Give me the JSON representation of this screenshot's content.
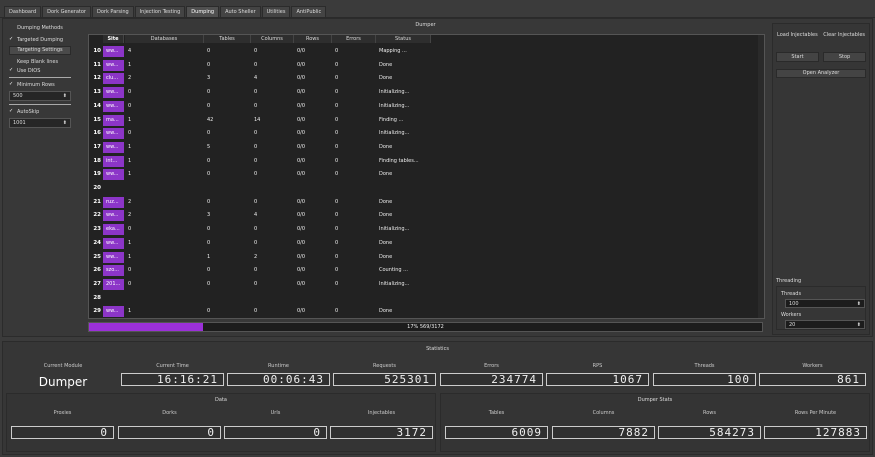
{
  "tabs": [
    "Dashboard",
    "Dork Generator",
    "Dork Parsing",
    "Injection Testing",
    "Dumping",
    "Auto Sheller",
    "Utilities",
    "AntiPublic"
  ],
  "active_tab": "Dumping",
  "left": {
    "header": "Dumping Methods",
    "targeted_dumping": "Targeted Dumping",
    "targeting_settings": "Targeting Settings",
    "keep_blank_lines": "Keep Blank lines",
    "use_dios": "Use DIOS",
    "minimum_rows": "Minimum Rows",
    "minimum_rows_value": "500",
    "autoskip": "AutoSkip",
    "autoskip_value": "1001"
  },
  "dumper": {
    "title": "Dumper",
    "columns": [
      "Site",
      "Databases",
      "Tables",
      "Columns",
      "Rows",
      "Errors",
      "Status"
    ],
    "rows": [
      {
        "n": "10",
        "site": "ww...",
        "db": "4",
        "tables": "0",
        "columns": "0",
        "rows": "0/0",
        "errors": "0",
        "status": "Mapping ..."
      },
      {
        "n": "11",
        "site": "ww...",
        "db": "1",
        "tables": "0",
        "columns": "0",
        "rows": "0/0",
        "errors": "0",
        "status": "Done"
      },
      {
        "n": "12",
        "site": "clu...",
        "db": "2",
        "tables": "3",
        "columns": "4",
        "rows": "0/0",
        "errors": "0",
        "status": "Done"
      },
      {
        "n": "13",
        "site": "ww...",
        "db": "0",
        "tables": "0",
        "columns": "0",
        "rows": "0/0",
        "errors": "0",
        "status": "Initializing..."
      },
      {
        "n": "14",
        "site": "ww...",
        "db": "0",
        "tables": "0",
        "columns": "0",
        "rows": "0/0",
        "errors": "0",
        "status": "Initializing..."
      },
      {
        "n": "15",
        "site": "ma...",
        "db": "1",
        "tables": "42",
        "columns": "14",
        "rows": "0/0",
        "errors": "0",
        "status": "Finding ..."
      },
      {
        "n": "16",
        "site": "ww...",
        "db": "0",
        "tables": "0",
        "columns": "0",
        "rows": "0/0",
        "errors": "0",
        "status": "Initializing..."
      },
      {
        "n": "17",
        "site": "ww...",
        "db": "1",
        "tables": "5",
        "columns": "0",
        "rows": "0/0",
        "errors": "0",
        "status": "Done"
      },
      {
        "n": "18",
        "site": "int...",
        "db": "1",
        "tables": "0",
        "columns": "0",
        "rows": "0/0",
        "errors": "0",
        "status": "Finding tables..."
      },
      {
        "n": "19",
        "site": "ww...",
        "db": "1",
        "tables": "0",
        "columns": "0",
        "rows": "0/0",
        "errors": "0",
        "status": "Done"
      },
      {
        "n": "20",
        "site": "",
        "db": "",
        "tables": "",
        "columns": "",
        "rows": "",
        "errors": "",
        "status": ""
      },
      {
        "n": "21",
        "site": "ruz...",
        "db": "2",
        "tables": "0",
        "columns": "0",
        "rows": "0/0",
        "errors": "0",
        "status": "Done"
      },
      {
        "n": "22",
        "site": "ww...",
        "db": "2",
        "tables": "3",
        "columns": "4",
        "rows": "0/0",
        "errors": "0",
        "status": "Done"
      },
      {
        "n": "23",
        "site": "eka...",
        "db": "0",
        "tables": "0",
        "columns": "0",
        "rows": "0/0",
        "errors": "0",
        "status": "Initializing..."
      },
      {
        "n": "24",
        "site": "ww...",
        "db": "1",
        "tables": "0",
        "columns": "0",
        "rows": "0/0",
        "errors": "0",
        "status": "Done"
      },
      {
        "n": "25",
        "site": "ww...",
        "db": "1",
        "tables": "1",
        "columns": "2",
        "rows": "0/0",
        "errors": "0",
        "status": "Done"
      },
      {
        "n": "26",
        "site": "szo...",
        "db": "0",
        "tables": "0",
        "columns": "0",
        "rows": "0/0",
        "errors": "0",
        "status": "Counting ..."
      },
      {
        "n": "27",
        "site": "201...",
        "db": "0",
        "tables": "0",
        "columns": "0",
        "rows": "0/0",
        "errors": "0",
        "status": "Initializing..."
      },
      {
        "n": "28",
        "site": "",
        "db": "",
        "tables": "",
        "columns": "",
        "rows": "",
        "errors": "",
        "status": ""
      },
      {
        "n": "29",
        "site": "ww...",
        "db": "1",
        "tables": "0",
        "columns": "0",
        "rows": "0/0",
        "errors": "0",
        "status": "Done"
      }
    ],
    "progress_text": "17% 569/3172",
    "progress_fraction": 0.17
  },
  "right": {
    "load_injectables": "Load Injectables",
    "clear_injectables": "Clear Injectables",
    "start": "Start",
    "stop": "Stop",
    "open_analyzer": "Open Analyzer",
    "threading": "Threading",
    "threads_label": "Threads",
    "threads_value": "100",
    "workers_label": "Workers",
    "workers_value": "20"
  },
  "stats": {
    "title": "Statistics",
    "current_module_label": "Current Module",
    "current_module": "Dumper",
    "current_time_label": "Current Time",
    "current_time": "16:16:21",
    "runtime_label": "Runtime",
    "runtime": "00:06:43",
    "requests_label": "Requests",
    "requests": "525301",
    "errors_label": "Errors",
    "errors": "234774",
    "rps_label": "RPS",
    "rps": "1067",
    "threads_label": "Threads",
    "threads": "100",
    "workers_label": "Workers",
    "workers": "861"
  },
  "data_group": {
    "title": "Data",
    "proxies_label": "Proxies",
    "proxies": "0",
    "dorks_label": "Dorks",
    "dorks": "0",
    "urls_label": "Urls",
    "urls": "0",
    "injectables_label": "Injectables",
    "injectables": "3172"
  },
  "dumper_stats": {
    "title": "Dumper Stats",
    "tables_label": "Tables",
    "tables": "6009",
    "columns_label": "Columns",
    "columns": "7882",
    "rows_label": "Rows",
    "rows": "584273",
    "rpm_label": "Rows Per Minute",
    "rpm": "127883"
  }
}
